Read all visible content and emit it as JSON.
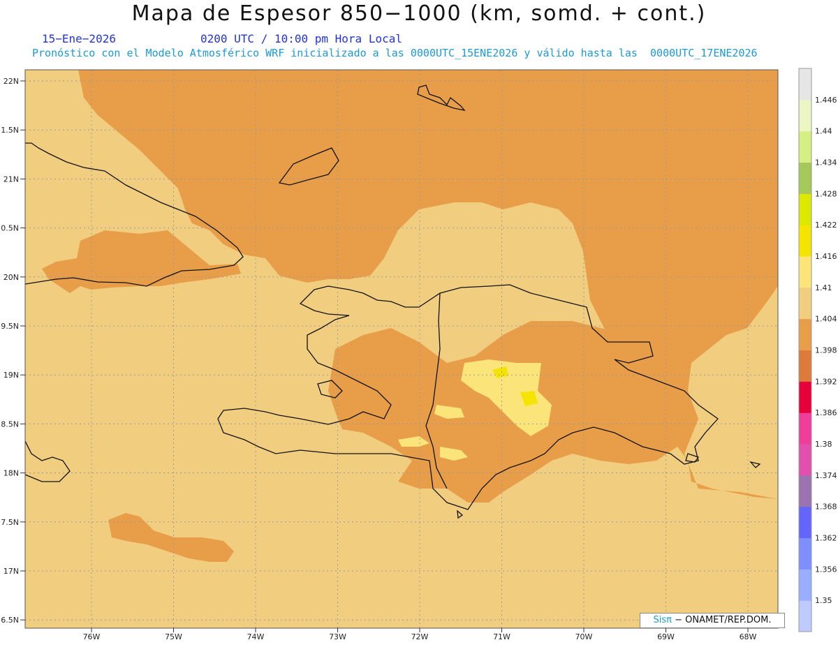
{
  "title": "Mapa de Espesor 850−1000 (km, somd. + cont.)",
  "date_text": "15−Ene−2026",
  "time_text": "0200 UTC / 10:00 pm Hora Local",
  "description": "Pronóstico con el Modelo Atmosférico WRF inicializado a las 0000UTC_15ENE2026 y válido hasta las  0000UTC_17ENE2026",
  "credit": {
    "logo": "Sisπ",
    "text": "− ONAMET/REP.DOM."
  },
  "lat_labels": [
    "22N",
    "1.5N",
    "21N",
    "0.5N",
    "20N",
    "9.5N",
    "19N",
    "8.5N",
    "18N",
    "7.5N",
    "17N",
    "6.5N"
  ],
  "lon_labels": [
    "76W",
    "75W",
    "74W",
    "73W",
    "72W",
    "71W",
    "70W",
    "69W",
    "68W"
  ],
  "colorbar": {
    "levels": [
      "1.35",
      "1.356",
      "1.362",
      "1.368",
      "1.374",
      "1.38",
      "1.386",
      "1.392",
      "1.398",
      "1.404",
      "1.41",
      "1.416",
      "1.422",
      "1.428",
      "1.434",
      "1.44",
      "1.446"
    ],
    "colors": [
      "#bfcaff",
      "#9aaeff",
      "#7f8fff",
      "#6464ff",
      "#9a73b0",
      "#e34fac",
      "#ee3e9a",
      "#e8003a",
      "#df7b3a",
      "#e89e48",
      "#f1cd80",
      "#fbe47a",
      "#f5e300",
      "#dde800",
      "#a4c85a",
      "#d6ef82",
      "#ecf6c4",
      "#e6e6e6"
    ]
  },
  "field_colors": {
    "low": "#e89e48",
    "mid": "#f1cd80",
    "high": "#fbe47a",
    "peak": "#f5e300",
    "coast": "#111111"
  }
}
